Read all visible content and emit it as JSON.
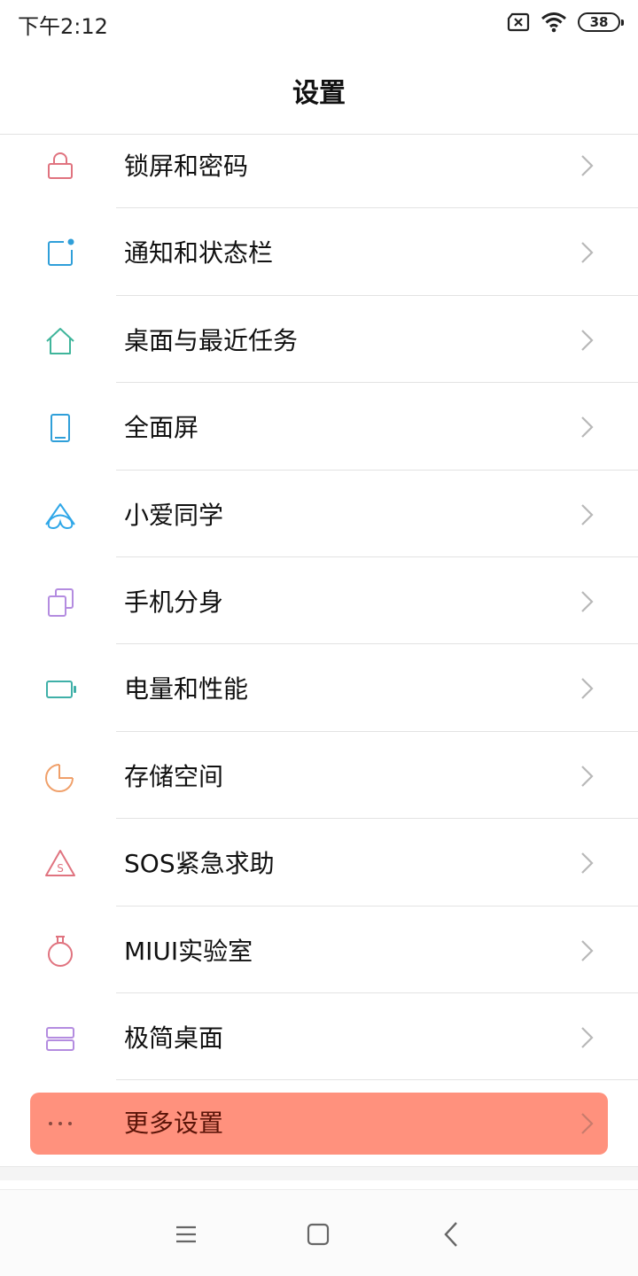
{
  "status_bar": {
    "time": "下午2:12",
    "battery": "38",
    "icons": [
      "sim-missing-icon",
      "wifi-icon",
      "battery-icon"
    ]
  },
  "header": {
    "title": "设置"
  },
  "settings": {
    "items": [
      {
        "label": "锁屏和密码",
        "icon": "lock-icon",
        "color": "#e0737f"
      },
      {
        "label": "通知和状态栏",
        "icon": "notification-icon",
        "color": "#2f9fd9"
      },
      {
        "label": "桌面与最近任务",
        "icon": "home-icon",
        "color": "#3fb59b"
      },
      {
        "label": "全面屏",
        "icon": "phone-screen-icon",
        "color": "#2f9fd9"
      },
      {
        "label": "小爱同学",
        "icon": "xiaoai-icon",
        "color": "#2fa7e8"
      },
      {
        "label": "手机分身",
        "icon": "dual-space-icon",
        "color": "#b48ce0"
      },
      {
        "label": "电量和性能",
        "icon": "battery-icon",
        "color": "#3fb0a8"
      },
      {
        "label": "存储空间",
        "icon": "storage-pie-icon",
        "color": "#f0a06a"
      },
      {
        "label": "SOS紧急求助",
        "icon": "sos-icon",
        "color": "#e0737f"
      },
      {
        "label": "MIUI实验室",
        "icon": "lab-flask-icon",
        "color": "#e0737f"
      },
      {
        "label": "极简桌面",
        "icon": "simple-desktop-icon",
        "color": "#b48ce0"
      }
    ],
    "more": {
      "label": "更多设置",
      "icon": "more-dots-icon",
      "color": "#8a4a40"
    }
  },
  "colors": {
    "highlight": "#ff917d",
    "chevron": "#b8b8b8"
  },
  "nav_bar": {
    "buttons": [
      "menu-icon",
      "home-square-icon",
      "back-icon"
    ]
  }
}
